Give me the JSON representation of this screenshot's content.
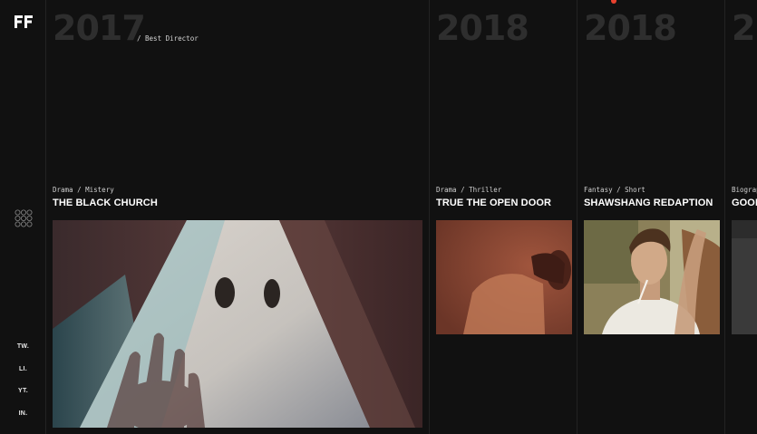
{
  "sidebar": {
    "logo_text": "FF",
    "social": [
      {
        "label": "TW."
      },
      {
        "label": "LI."
      },
      {
        "label": "YT."
      },
      {
        "label": "IN."
      }
    ]
  },
  "films": [
    {
      "year": "2017",
      "award": "/ Best Director",
      "genre": "Drama / Mistery",
      "title": "THE BLACK CHURCH"
    },
    {
      "year": "2018",
      "award": "",
      "genre": "Drama / Thriller",
      "title": "TRUE THE OPEN DOOR"
    },
    {
      "year": "2018",
      "award": "",
      "genre": "Fantasy / Short",
      "title": "SHAWSHANG REDAPTION"
    },
    {
      "year": "2",
      "award": "",
      "genre": "Biograp",
      "title": "GOOD"
    }
  ],
  "colors": {
    "background": "#111111",
    "year_text": "#2e2e2e",
    "indicator": "#e8412e"
  }
}
